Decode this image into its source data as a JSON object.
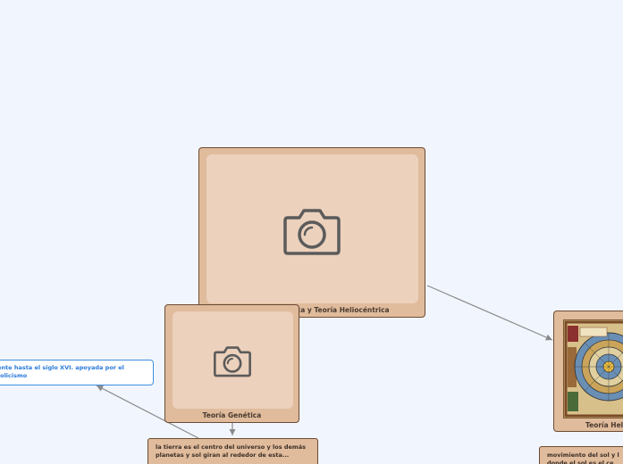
{
  "nodes": {
    "main": {
      "label": "Teoría Geocéntrica y Teoría Heliocéntrica",
      "icon": "camera-icon"
    },
    "genetica": {
      "label": "Teoría Genética",
      "icon": "camera-icon"
    },
    "helio": {
      "label": "Teoría Heli",
      "image": "celestial-map-image"
    }
  },
  "notes": {
    "geo_desc": "la tierra es el centro del universo y los demás planetas y sol giran al rededor de esta...",
    "helio_desc": "movimiento del sol y l donde el sol es el ce",
    "blue_desc": "ente hasta el siglo XVI. apoyada por el tolicismo"
  },
  "colors": {
    "background": "#f1f5fd",
    "node_fill": "#e0bb9c",
    "node_inner": "#ecd1bc",
    "node_border": "#6b4b34",
    "connector": "#8a8a8a",
    "blue_accent": "#3d8fe0"
  }
}
